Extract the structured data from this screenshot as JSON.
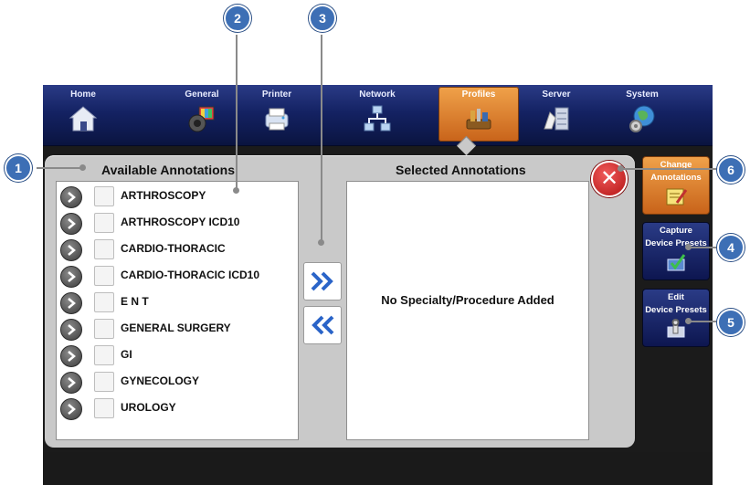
{
  "nav": {
    "items": [
      {
        "label": "Home",
        "icon": "house-icon"
      },
      {
        "label": "General",
        "icon": "speaker-monitor-icon"
      },
      {
        "label": "Printer",
        "icon": "printer-icon"
      },
      {
        "label": "Network",
        "icon": "network-icon"
      },
      {
        "label": "Profiles",
        "icon": "tools-icon",
        "active": true
      },
      {
        "label": "Server",
        "icon": "server-icon"
      },
      {
        "label": "System",
        "icon": "globe-gear-icon"
      }
    ]
  },
  "available": {
    "title": "Available Annotations",
    "items": [
      "ARTHROSCOPY",
      "ARTHROSCOPY ICD10",
      "CARDIO-THORACIC",
      "CARDIO-THORACIC ICD10",
      "E N T",
      "GENERAL SURGERY",
      "GI",
      "GYNECOLOGY",
      "UROLOGY"
    ]
  },
  "selected": {
    "title": "Selected Annotations",
    "empty_message": "No Specialty/Procedure Added"
  },
  "side": {
    "change_line1": "Change",
    "change_line2": "Annotations",
    "capture_line1": "Capture",
    "capture_line2": "Device Presets",
    "edit_line1": "Edit",
    "edit_line2": "Device Presets"
  },
  "callouts": [
    "1",
    "2",
    "3",
    "4",
    "5",
    "6"
  ],
  "colors": {
    "nav_bg": "#142263",
    "active_orange": "#e0893a",
    "callout_blue": "#3d6fb5",
    "close_red": "#c81e1e",
    "panel_gray": "#c9c9c9"
  }
}
